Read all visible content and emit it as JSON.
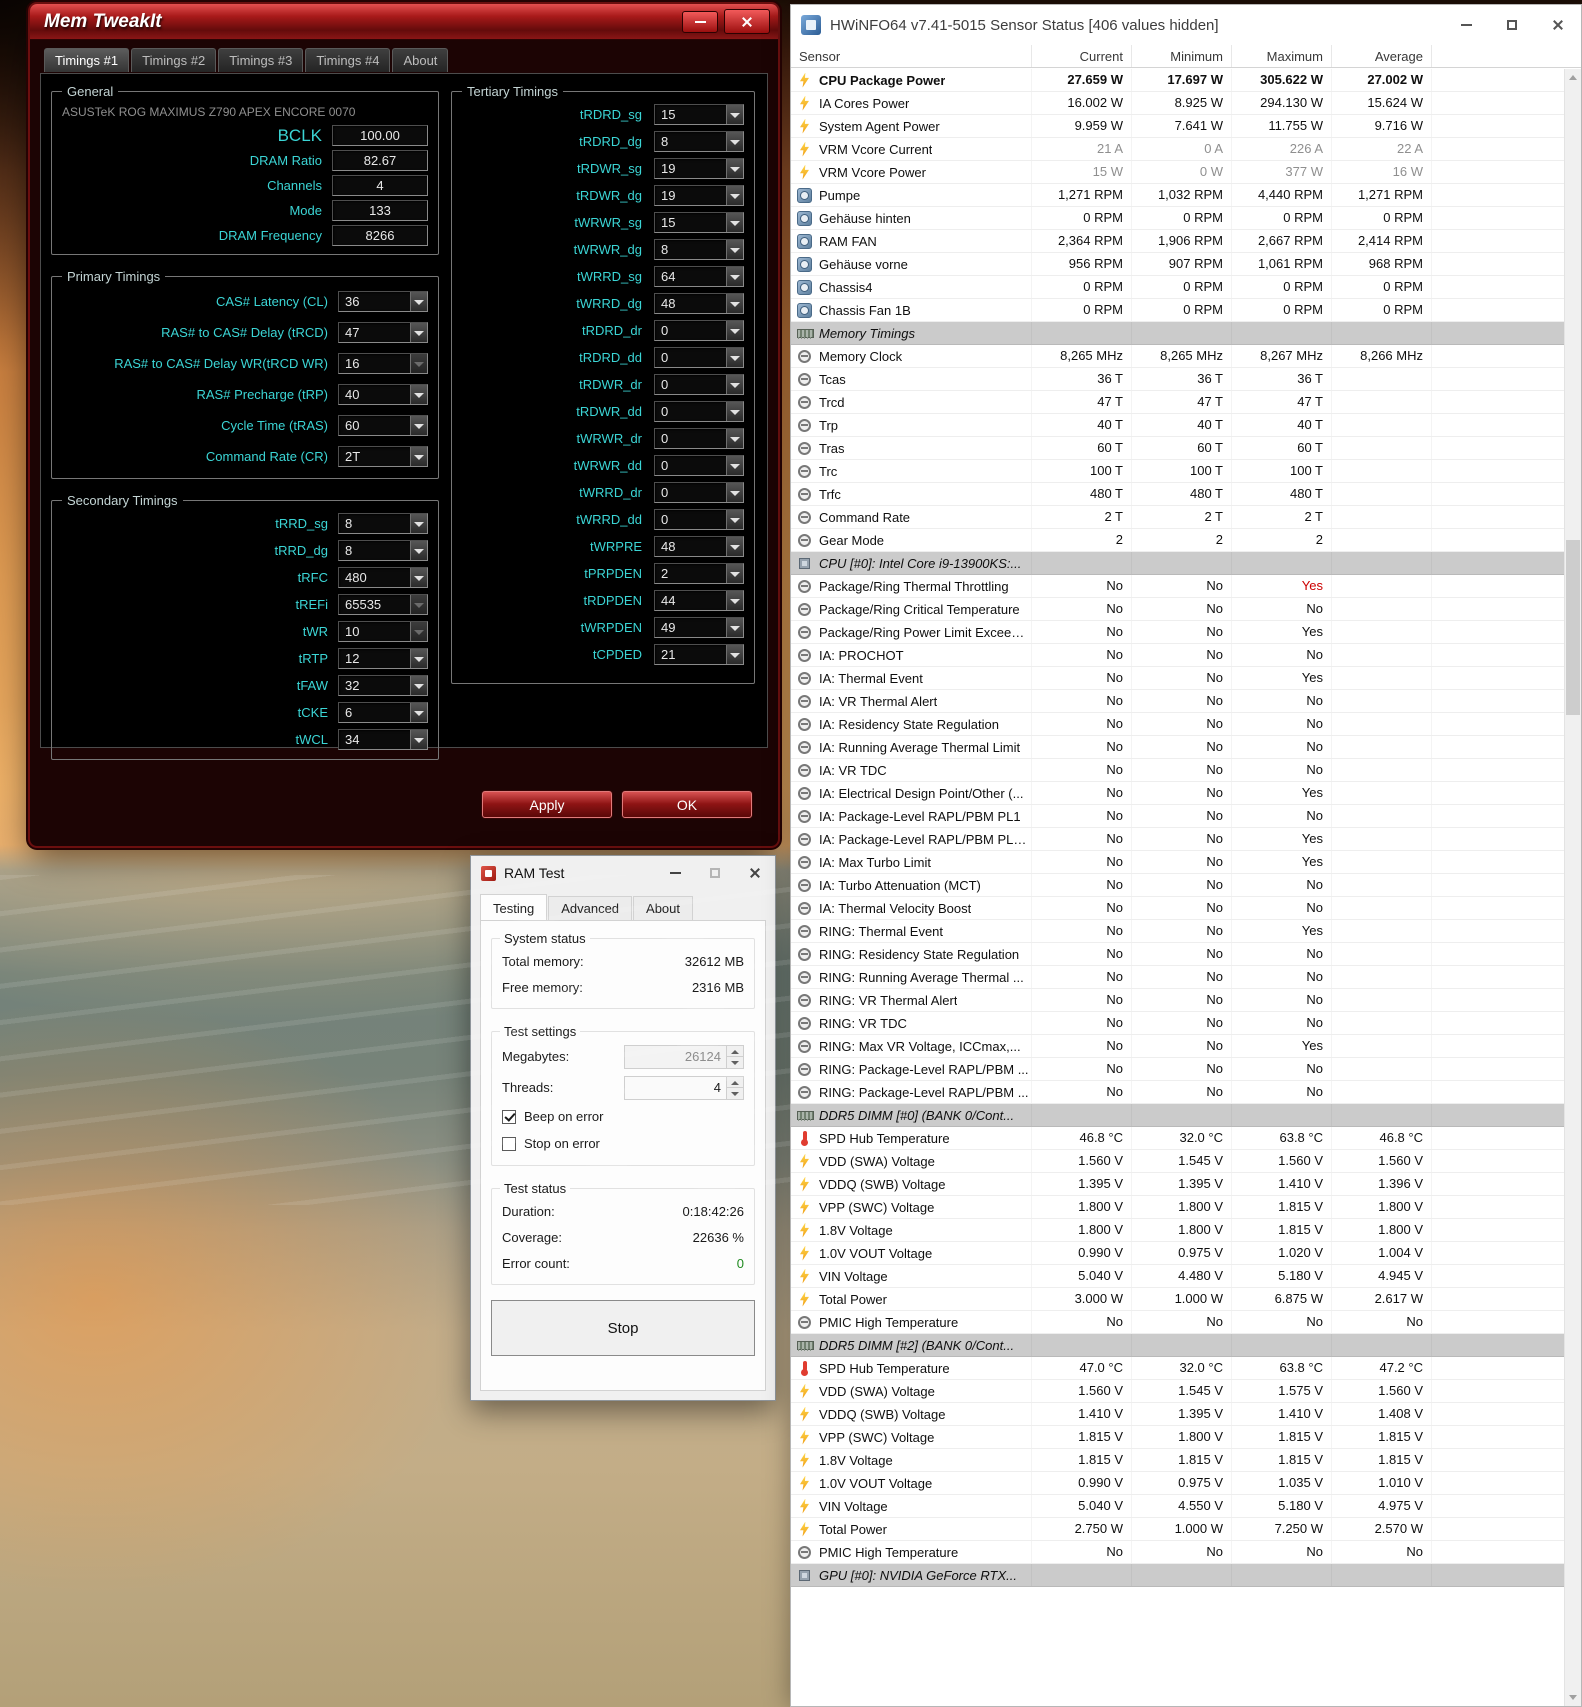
{
  "colors": {
    "alert_red": "#cc0000",
    "ok_green": "#1f8a1f",
    "timing_label_cyan": "#3bd5d5",
    "memtweakit_red": "#9b1414"
  },
  "memtweakit": {
    "title": "Mem TweakIt",
    "tabs": [
      {
        "label": "Timings #1",
        "cls": "active"
      },
      {
        "label": "Timings #2"
      },
      {
        "label": "Timings #3"
      },
      {
        "label": "Timings #4"
      },
      {
        "label": "About"
      }
    ],
    "general": {
      "label": "General",
      "board": "ASUSTeK ROG MAXIMUS Z790 APEX ENCORE 0070",
      "fields": [
        {
          "label": "BCLK",
          "value": "100.00",
          "cls": "big"
        },
        {
          "label": "DRAM Ratio",
          "value": "82.67"
        },
        {
          "label": "Channels",
          "value": "4"
        },
        {
          "label": "Mode",
          "value": "133"
        },
        {
          "label": "DRAM Frequency",
          "value": "8266"
        }
      ]
    },
    "primary": {
      "label": "Primary Timings",
      "fields": [
        {
          "label": "CAS# Latency (CL)",
          "value": "36"
        },
        {
          "label": "RAS# to CAS# Delay (tRCD)",
          "value": "47"
        },
        {
          "label": "RAS# to CAS# Delay WR(tRCD WR)",
          "value": "16",
          "cls": "disabled"
        },
        {
          "label": "RAS# Precharge (tRP)",
          "value": "40"
        },
        {
          "label": "Cycle Time (tRAS)",
          "value": "60"
        },
        {
          "label": "Command Rate (CR)",
          "value": "2T"
        }
      ]
    },
    "secondary": {
      "label": "Secondary Timings",
      "fields": [
        {
          "label": "tRRD_sg",
          "value": "8"
        },
        {
          "label": "tRRD_dg",
          "value": "8"
        },
        {
          "label": "tRFC",
          "value": "480"
        },
        {
          "label": "tREFi",
          "value": "65535",
          "cls": "disabled"
        },
        {
          "label": "tWR",
          "value": "10",
          "cls": "disabled"
        },
        {
          "label": "tRTP",
          "value": "12"
        },
        {
          "label": "tFAW",
          "value": "32"
        },
        {
          "label": "tCKE",
          "value": "6"
        },
        {
          "label": "tWCL",
          "value": "34"
        }
      ]
    },
    "tertiary": {
      "label": "Tertiary Timings",
      "fields": [
        {
          "label": "tRDRD_sg",
          "value": "15"
        },
        {
          "label": "tRDRD_dg",
          "value": "8"
        },
        {
          "label": "tRDWR_sg",
          "value": "19"
        },
        {
          "label": "tRDWR_dg",
          "value": "19"
        },
        {
          "label": "tWRWR_sg",
          "value": "15"
        },
        {
          "label": "tWRWR_dg",
          "value": "8"
        },
        {
          "label": "tWRRD_sg",
          "value": "64"
        },
        {
          "label": "tWRRD_dg",
          "value": "48"
        },
        {
          "label": "tRDRD_dr",
          "value": "0"
        },
        {
          "label": "tRDRD_dd",
          "value": "0"
        },
        {
          "label": "tRDWR_dr",
          "value": "0"
        },
        {
          "label": "tRDWR_dd",
          "value": "0"
        },
        {
          "label": "tWRWR_dr",
          "value": "0"
        },
        {
          "label": "tWRWR_dd",
          "value": "0"
        },
        {
          "label": "tWRRD_dr",
          "value": "0"
        },
        {
          "label": "tWRRD_dd",
          "value": "0"
        },
        {
          "label": "tWRPRE",
          "value": "48"
        },
        {
          "label": "tPRPDEN",
          "value": "2"
        },
        {
          "label": "tRDPDEN",
          "value": "44"
        },
        {
          "label": "tWRPDEN",
          "value": "49"
        },
        {
          "label": "tCPDED",
          "value": "21"
        }
      ]
    },
    "apply_label": "Apply",
    "ok_label": "OK"
  },
  "ramtest": {
    "title": "RAM Test",
    "tabs": [
      {
        "label": "Testing",
        "cls": "active"
      },
      {
        "label": "Advanced"
      },
      {
        "label": "About"
      }
    ],
    "system_status": {
      "label": "System status",
      "rows": [
        {
          "label": "Total memory:",
          "value": "32612 MB"
        },
        {
          "label": "Free memory:",
          "value": "2316 MB"
        }
      ]
    },
    "test_settings": {
      "label": "Test settings",
      "megabytes_label": "Megabytes:",
      "megabytes_value": "26124",
      "threads_label": "Threads:",
      "threads_value": "4",
      "checkboxes": [
        {
          "label": "Beep on error",
          "cls": "checked"
        },
        {
          "label": "Stop on error"
        }
      ]
    },
    "test_status": {
      "label": "Test status",
      "rows": [
        {
          "label": "Duration:",
          "value": "0:18:42:26"
        },
        {
          "label": "Coverage:",
          "value": "22636 %"
        },
        {
          "label": "Error count:",
          "value": "0",
          "cls": "green"
        }
      ]
    },
    "stop_label": "Stop"
  },
  "hwinfo": {
    "title": "HWiNFO64 v7.41-5015 Sensor Status [406 values hidden]",
    "columns": {
      "sensor": "Sensor",
      "current": "Current",
      "minimum": "Minimum",
      "maximum": "Maximum",
      "average": "Average"
    },
    "rows": [
      {
        "icon": "power",
        "name": "CPU Package Power",
        "c": "27.659 W",
        "m": "17.697 W",
        "x": "305.622 W",
        "a": "27.002 W",
        "cls": "bold"
      },
      {
        "icon": "power",
        "name": "IA Cores Power",
        "c": "16.002 W",
        "m": "8.925 W",
        "x": "294.130 W",
        "a": "15.624 W"
      },
      {
        "icon": "power",
        "name": "System Agent Power",
        "c": "9.959 W",
        "m": "7.641 W",
        "x": "11.755 W",
        "a": "9.716 W"
      },
      {
        "icon": "power",
        "name": "VRM Vcore Current",
        "c": "21 A",
        "m": "0 A",
        "x": "226 A",
        "a": "22 A",
        "cls": "dim"
      },
      {
        "icon": "power",
        "name": "VRM Vcore Power",
        "c": "15 W",
        "m": "0 W",
        "x": "377 W",
        "a": "16 W",
        "cls": "dim"
      },
      {
        "icon": "fan",
        "name": "Pumpe",
        "c": "1,271 RPM",
        "m": "1,032 RPM",
        "x": "4,440 RPM",
        "a": "1,271 RPM"
      },
      {
        "icon": "fan",
        "name": "Gehäuse hinten",
        "c": "0 RPM",
        "m": "0 RPM",
        "x": "0 RPM",
        "a": "0 RPM"
      },
      {
        "icon": "fan",
        "name": "RAM FAN",
        "c": "2,364 RPM",
        "m": "1,906 RPM",
        "x": "2,667 RPM",
        "a": "2,414 RPM"
      },
      {
        "icon": "fan",
        "name": "Gehäuse vorne",
        "c": "956 RPM",
        "m": "907 RPM",
        "x": "1,061 RPM",
        "a": "968 RPM"
      },
      {
        "icon": "fan",
        "name": "Chassis4",
        "c": "0 RPM",
        "m": "0 RPM",
        "x": "0 RPM",
        "a": "0 RPM"
      },
      {
        "icon": "fan",
        "name": "Chassis Fan 1B",
        "c": "0 RPM",
        "m": "0 RPM",
        "x": "0 RPM",
        "a": "0 RPM"
      },
      {
        "icon": "mem",
        "name": "Memory Timings",
        "cls": "section"
      },
      {
        "icon": "clock",
        "name": "Memory Clock",
        "c": "8,265 MHz",
        "m": "8,265 MHz",
        "x": "8,267 MHz",
        "a": "8,266 MHz"
      },
      {
        "icon": "clock",
        "name": "Tcas",
        "c": "36 T",
        "m": "36 T",
        "x": "36 T"
      },
      {
        "icon": "clock",
        "name": "Trcd",
        "c": "47 T",
        "m": "47 T",
        "x": "47 T"
      },
      {
        "icon": "clock",
        "name": "Trp",
        "c": "40 T",
        "m": "40 T",
        "x": "40 T"
      },
      {
        "icon": "clock",
        "name": "Tras",
        "c": "60 T",
        "m": "60 T",
        "x": "60 T"
      },
      {
        "icon": "clock",
        "name": "Trc",
        "c": "100 T",
        "m": "100 T",
        "x": "100 T"
      },
      {
        "icon": "clock",
        "name": "Trfc",
        "c": "480 T",
        "m": "480 T",
        "x": "480 T"
      },
      {
        "icon": "clock",
        "name": "Command Rate",
        "c": "2 T",
        "m": "2 T",
        "x": "2 T"
      },
      {
        "icon": "clock",
        "name": "Gear Mode",
        "c": "2",
        "m": "2",
        "x": "2"
      },
      {
        "icon": "cpu",
        "name": "CPU [#0]: Intel Core i9-13900KS:...",
        "cls": "section"
      },
      {
        "icon": "clock",
        "name": "Package/Ring Thermal Throttling",
        "c": "No",
        "m": "No",
        "x": "Yes",
        "cls": "redmax"
      },
      {
        "icon": "clock",
        "name": "Package/Ring Critical Temperature",
        "c": "No",
        "m": "No",
        "x": "No"
      },
      {
        "icon": "clock",
        "name": "Package/Ring Power Limit Exceeded",
        "c": "No",
        "m": "No",
        "x": "Yes"
      },
      {
        "icon": "clock",
        "name": "IA: PROCHOT",
        "c": "No",
        "m": "No",
        "x": "No"
      },
      {
        "icon": "clock",
        "name": "IA: Thermal Event",
        "c": "No",
        "m": "No",
        "x": "Yes"
      },
      {
        "icon": "clock",
        "name": "IA: VR Thermal Alert",
        "c": "No",
        "m": "No",
        "x": "No"
      },
      {
        "icon": "clock",
        "name": "IA: Residency State Regulation",
        "c": "No",
        "m": "No",
        "x": "No"
      },
      {
        "icon": "clock",
        "name": "IA: Running Average Thermal Limit",
        "c": "No",
        "m": "No",
        "x": "No"
      },
      {
        "icon": "clock",
        "name": "IA: VR TDC",
        "c": "No",
        "m": "No",
        "x": "No"
      },
      {
        "icon": "clock",
        "name": "IA: Electrical Design Point/Other (...",
        "c": "No",
        "m": "No",
        "x": "Yes"
      },
      {
        "icon": "clock",
        "name": "IA: Package-Level RAPL/PBM PL1",
        "c": "No",
        "m": "No",
        "x": "No"
      },
      {
        "icon": "clock",
        "name": "IA: Package-Level RAPL/PBM PL2...",
        "c": "No",
        "m": "No",
        "x": "Yes"
      },
      {
        "icon": "clock",
        "name": "IA: Max Turbo Limit",
        "c": "No",
        "m": "No",
        "x": "Yes"
      },
      {
        "icon": "clock",
        "name": "IA: Turbo Attenuation (MCT)",
        "c": "No",
        "m": "No",
        "x": "No"
      },
      {
        "icon": "clock",
        "name": "IA: Thermal Velocity Boost",
        "c": "No",
        "m": "No",
        "x": "No"
      },
      {
        "icon": "clock",
        "name": "RING: Thermal Event",
        "c": "No",
        "m": "No",
        "x": "Yes"
      },
      {
        "icon": "clock",
        "name": "RING: Residency State Regulation",
        "c": "No",
        "m": "No",
        "x": "No"
      },
      {
        "icon": "clock",
        "name": "RING: Running Average Thermal ...",
        "c": "No",
        "m": "No",
        "x": "No"
      },
      {
        "icon": "clock",
        "name": "RING: VR Thermal Alert",
        "c": "No",
        "m": "No",
        "x": "No"
      },
      {
        "icon": "clock",
        "name": "RING: VR TDC",
        "c": "No",
        "m": "No",
        "x": "No"
      },
      {
        "icon": "clock",
        "name": "RING: Max VR Voltage, ICCmax,...",
        "c": "No",
        "m": "No",
        "x": "Yes"
      },
      {
        "icon": "clock",
        "name": "RING: Package-Level RAPL/PBM ...",
        "c": "No",
        "m": "No",
        "x": "No"
      },
      {
        "icon": "clock",
        "name": "RING: Package-Level RAPL/PBM ...",
        "c": "No",
        "m": "No",
        "x": "No"
      },
      {
        "icon": "mem",
        "name": "DDR5 DIMM [#0] (BANK 0/Cont...",
        "cls": "section"
      },
      {
        "icon": "temp",
        "name": "SPD Hub Temperature",
        "c": "46.8 °C",
        "m": "32.0 °C",
        "x": "63.8 °C",
        "a": "46.8 °C"
      },
      {
        "icon": "power",
        "name": "VDD (SWA) Voltage",
        "c": "1.560 V",
        "m": "1.545 V",
        "x": "1.560 V",
        "a": "1.560 V"
      },
      {
        "icon": "power",
        "name": "VDDQ (SWB) Voltage",
        "c": "1.395 V",
        "m": "1.395 V",
        "x": "1.410 V",
        "a": "1.396 V"
      },
      {
        "icon": "power",
        "name": "VPP (SWC) Voltage",
        "c": "1.800 V",
        "m": "1.800 V",
        "x": "1.815 V",
        "a": "1.800 V"
      },
      {
        "icon": "power",
        "name": "1.8V Voltage",
        "c": "1.800 V",
        "m": "1.800 V",
        "x": "1.815 V",
        "a": "1.800 V"
      },
      {
        "icon": "power",
        "name": "1.0V VOUT Voltage",
        "c": "0.990 V",
        "m": "0.975 V",
        "x": "1.020 V",
        "a": "1.004 V"
      },
      {
        "icon": "power",
        "name": "VIN Voltage",
        "c": "5.040 V",
        "m": "4.480 V",
        "x": "5.180 V",
        "a": "4.945 V"
      },
      {
        "icon": "power",
        "name": "Total Power",
        "c": "3.000 W",
        "m": "1.000 W",
        "x": "6.875 W",
        "a": "2.617 W"
      },
      {
        "icon": "clock",
        "name": "PMIC High Temperature",
        "c": "No",
        "m": "No",
        "x": "No",
        "a": "No"
      },
      {
        "icon": "mem",
        "name": "DDR5 DIMM [#2] (BANK 0/Cont...",
        "cls": "section"
      },
      {
        "icon": "temp",
        "name": "SPD Hub Temperature",
        "c": "47.0 °C",
        "m": "32.0 °C",
        "x": "63.8 °C",
        "a": "47.2 °C"
      },
      {
        "icon": "power",
        "name": "VDD (SWA) Voltage",
        "c": "1.560 V",
        "m": "1.545 V",
        "x": "1.575 V",
        "a": "1.560 V"
      },
      {
        "icon": "power",
        "name": "VDDQ (SWB) Voltage",
        "c": "1.410 V",
        "m": "1.395 V",
        "x": "1.410 V",
        "a": "1.408 V"
      },
      {
        "icon": "power",
        "name": "VPP (SWC) Voltage",
        "c": "1.815 V",
        "m": "1.800 V",
        "x": "1.815 V",
        "a": "1.815 V"
      },
      {
        "icon": "power",
        "name": "1.8V Voltage",
        "c": "1.815 V",
        "m": "1.815 V",
        "x": "1.815 V",
        "a": "1.815 V"
      },
      {
        "icon": "power",
        "name": "1.0V VOUT Voltage",
        "c": "0.990 V",
        "m": "0.975 V",
        "x": "1.035 V",
        "a": "1.010 V"
      },
      {
        "icon": "power",
        "name": "VIN Voltage",
        "c": "5.040 V",
        "m": "4.550 V",
        "x": "5.180 V",
        "a": "4.975 V"
      },
      {
        "icon": "power",
        "name": "Total Power",
        "c": "2.750 W",
        "m": "1.000 W",
        "x": "7.250 W",
        "a": "2.570 W"
      },
      {
        "icon": "clock",
        "name": "PMIC High Temperature",
        "c": "No",
        "m": "No",
        "x": "No",
        "a": "No"
      },
      {
        "icon": "gpu",
        "name": "GPU [#0]: NVIDIA GeForce RTX...",
        "cls": "section"
      }
    ]
  }
}
